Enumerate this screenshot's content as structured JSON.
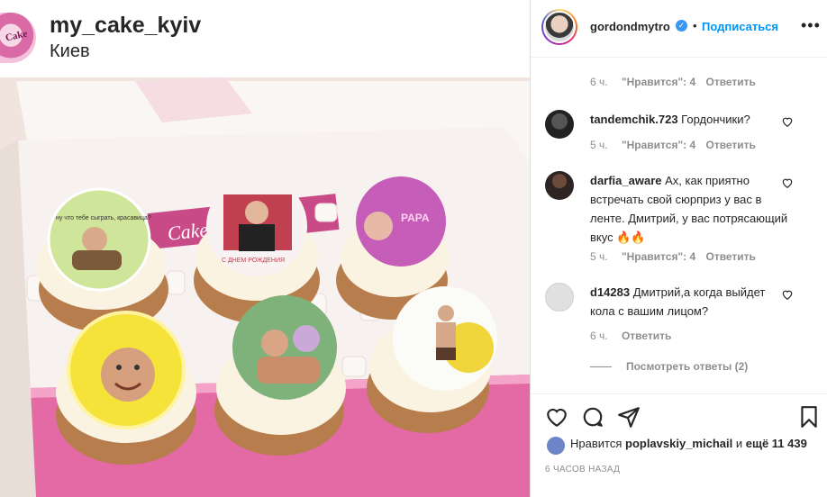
{
  "post": {
    "account": "my_cake_kyiv",
    "location": "Киев",
    "avatar_text": "Cake"
  },
  "panel": {
    "user": "gordondmytro",
    "dot": "•",
    "follow_label": "Подписаться",
    "more_label": "•••"
  },
  "comments": {
    "first_meta": {
      "time": "6 ч.",
      "likes": "\"Нравится\": 4",
      "reply": "Ответить"
    },
    "items": [
      {
        "user": "tandemchik.723",
        "text": "Гордончики?",
        "time": "5 ч.",
        "likes": "\"Нравится\": 4",
        "reply": "Ответить"
      },
      {
        "user": "darfia_aware",
        "text": "Ах, как приятно встречать свой сюрприз у вас в ленте. Дмитрий, у вас потрясающий вкус 🔥🔥",
        "time": "5 ч.",
        "likes": "\"Нравится\": 4",
        "reply": "Ответить"
      },
      {
        "user": "d14283",
        "text": "Дмитрий,а когда выйдет кола с вашим лицом?",
        "time": "6 ч.",
        "reply": "Ответить",
        "view_replies": "Посмотреть ответы (2)"
      }
    ]
  },
  "actions": {
    "likes_prefix": "Нравится",
    "likes_user": "poplavskiy_michail",
    "likes_mid": "и",
    "likes_count": "ещё 11 439",
    "time_ago": "6 ЧАСОВ НАЗАД"
  },
  "cupcake_labels": {
    "c1": "ну что тебе сыграть, красавица?",
    "c2": "С ДНЕМ РОЖДЕНИЯ",
    "c3": "PAPA"
  },
  "colors": {
    "link": "#0095f6",
    "muted": "#8e8e8e",
    "text": "#262626",
    "box_pink": "#e36aa5"
  }
}
